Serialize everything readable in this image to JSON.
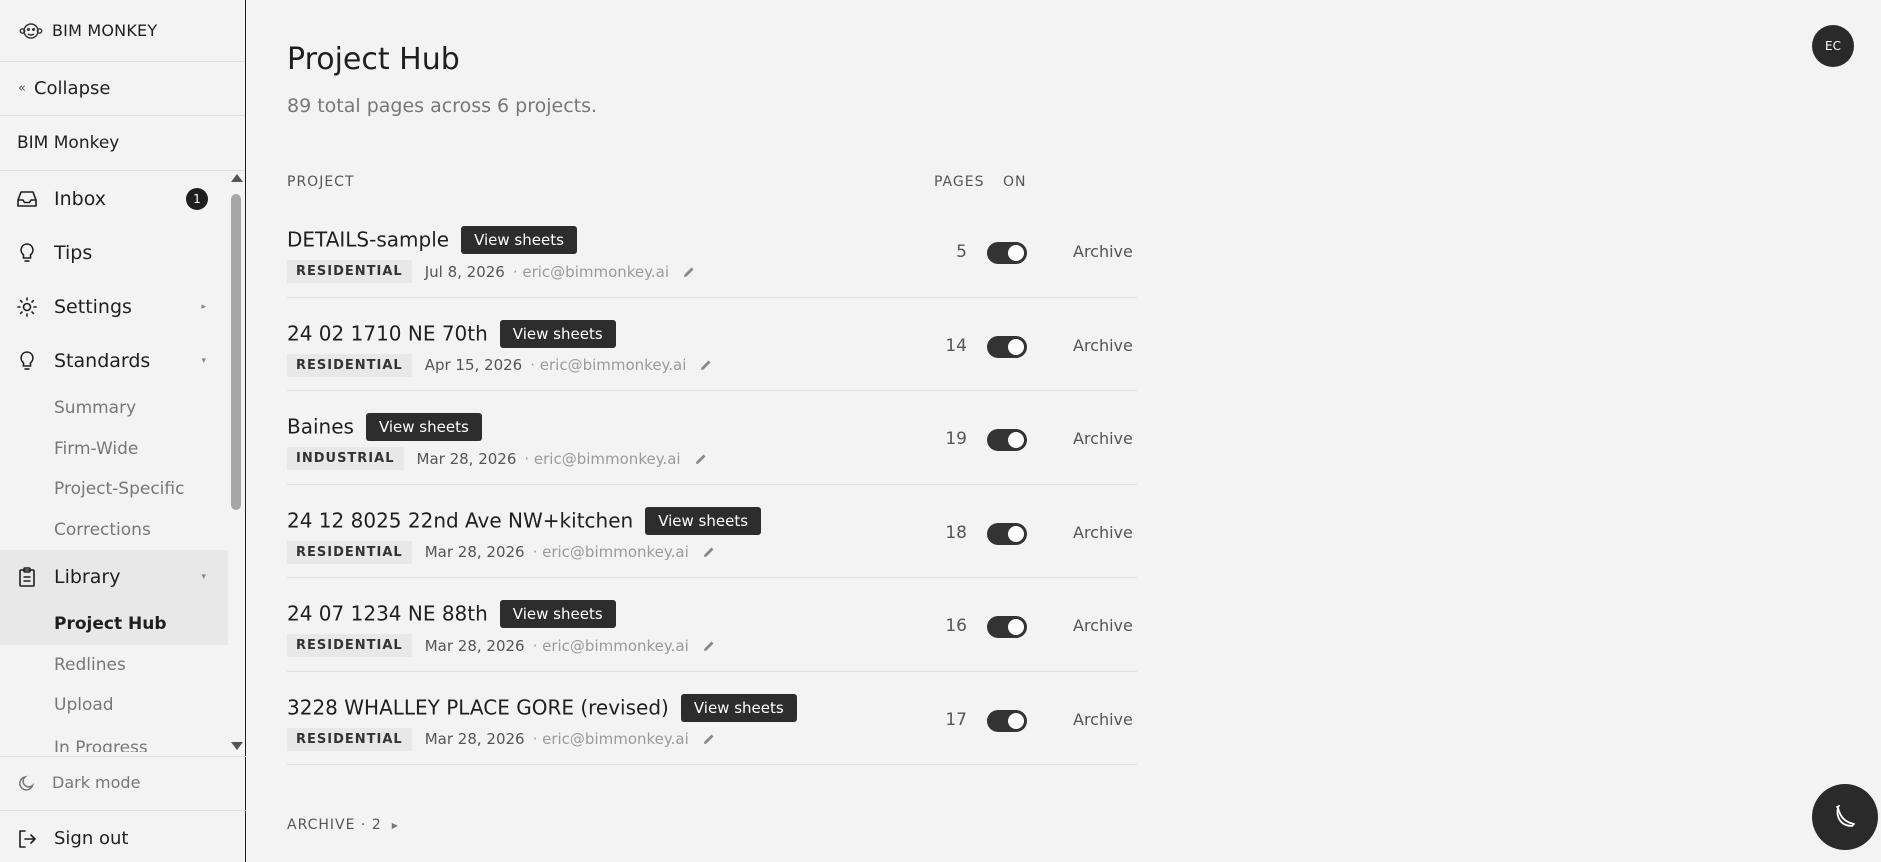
{
  "sidebar": {
    "brand": "BIM MONKEY",
    "collapse_label": "Collapse",
    "workspace": "BIM Monkey",
    "nav": {
      "inbox": {
        "label": "Inbox",
        "badge": "1"
      },
      "tips": {
        "label": "Tips"
      },
      "settings": {
        "label": "Settings"
      },
      "standards": {
        "label": "Standards"
      },
      "standards_sub": [
        "Summary",
        "Firm-Wide",
        "Project-Specific",
        "Corrections"
      ],
      "library": {
        "label": "Library"
      },
      "library_sub": [
        "Project Hub",
        "Redlines",
        "Upload",
        "In Progress"
      ]
    },
    "dark_mode": "Dark mode",
    "sign_out": "Sign out"
  },
  "header": {
    "title": "Project Hub",
    "subtitle": "89 total pages across 6 projects.",
    "avatar_initials": "EC"
  },
  "table": {
    "columns": {
      "project": "PROJECT",
      "pages": "PAGES",
      "on": "ON"
    },
    "view_sheets_label": "View sheets",
    "archive_label": "Archive",
    "rows": [
      {
        "name": "DETAILS-sample",
        "tag": "RESIDENTIAL",
        "date": "Jul 8, 2026",
        "email": "· eric@bimmonkey.ai",
        "pages": "5",
        "on": true
      },
      {
        "name": "24 02 1710 NE 70th",
        "tag": "RESIDENTIAL",
        "date": "Apr 15, 2026",
        "email": "· eric@bimmonkey.ai",
        "pages": "14",
        "on": true
      },
      {
        "name": "Baines",
        "tag": "INDUSTRIAL",
        "date": "Mar 28, 2026",
        "email": "· eric@bimmonkey.ai",
        "pages": "19",
        "on": true
      },
      {
        "name": "24 12 8025 22nd Ave NW+kitchen",
        "tag": "RESIDENTIAL",
        "date": "Mar 28, 2026",
        "email": "· eric@bimmonkey.ai",
        "pages": "18",
        "on": true
      },
      {
        "name": "24 07 1234 NE 88th",
        "tag": "RESIDENTIAL",
        "date": "Mar 28, 2026",
        "email": "· eric@bimmonkey.ai",
        "pages": "16",
        "on": true
      },
      {
        "name": "3228 WHALLEY PLACE GORE (revised)",
        "tag": "RESIDENTIAL",
        "date": "Mar 28, 2026",
        "email": "· eric@bimmonkey.ai",
        "pages": "17",
        "on": true
      }
    ]
  },
  "archive_section": {
    "label": "ARCHIVE · 2"
  },
  "colors": {
    "accent": "#2d2d2d",
    "background": "#f3f3f3",
    "muted_text": "#777777"
  }
}
